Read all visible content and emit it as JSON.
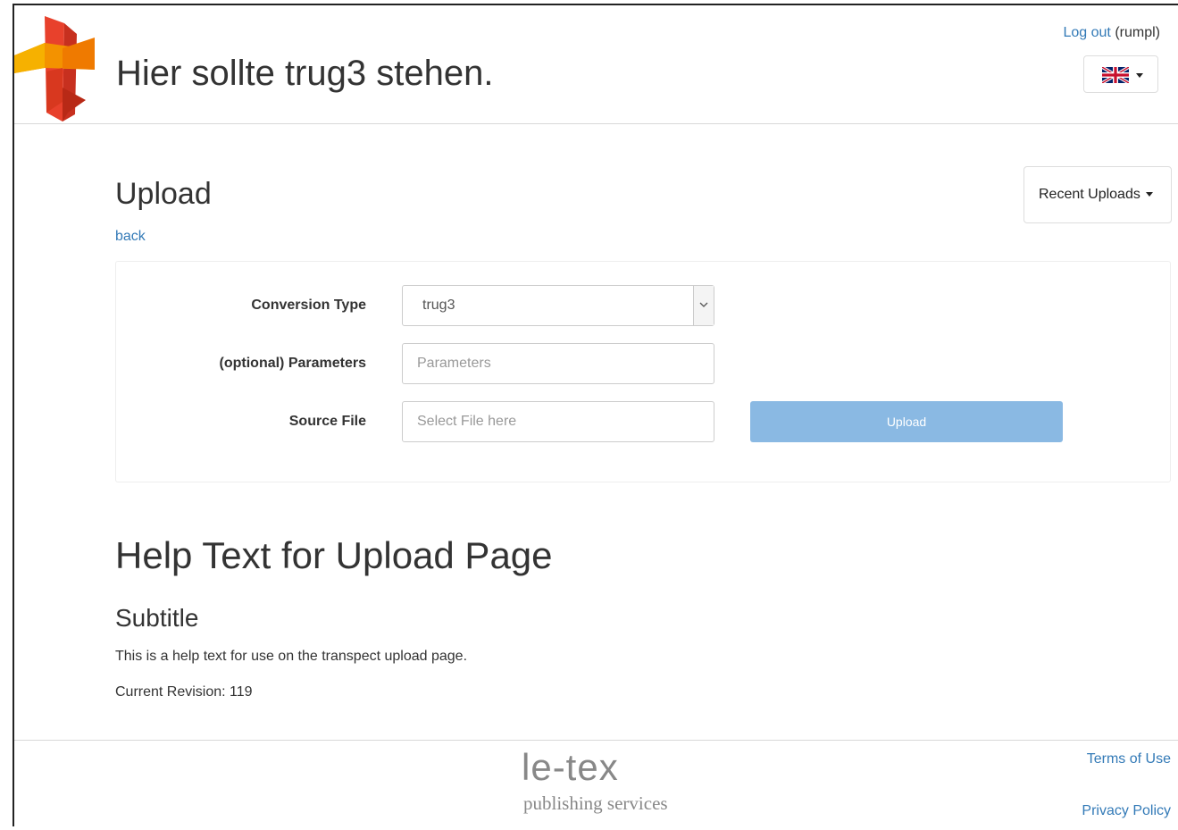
{
  "header": {
    "site_title": "Hier sollte trug3 stehen.",
    "logout_label": "Log out",
    "username": "(rumpl)",
    "language_icon": "uk-flag-icon"
  },
  "upload": {
    "title": "Upload",
    "back_label": "back",
    "recent_uploads_label": "Recent Uploads",
    "form": {
      "conversion_type_label": "Conversion Type",
      "conversion_type_value": "trug3",
      "parameters_label": "(optional) Parameters",
      "parameters_placeholder": "Parameters",
      "source_file_label": "Source File",
      "source_file_placeholder": "Select File here",
      "upload_button_label": "Upload"
    }
  },
  "help": {
    "title": "Help Text for Upload Page",
    "subtitle": "Subtitle",
    "body": "This is a help text for use on the transpect upload page.",
    "revision": "Current Revision: 119"
  },
  "footer": {
    "brand": "le-tex",
    "tagline": "publishing services",
    "terms_label": "Terms of Use",
    "privacy_label": "Privacy Policy"
  },
  "colors": {
    "link": "#337ab7",
    "upload_button": "#8ab9e3",
    "logo_red": "#e8412c",
    "logo_orange": "#f39200"
  }
}
